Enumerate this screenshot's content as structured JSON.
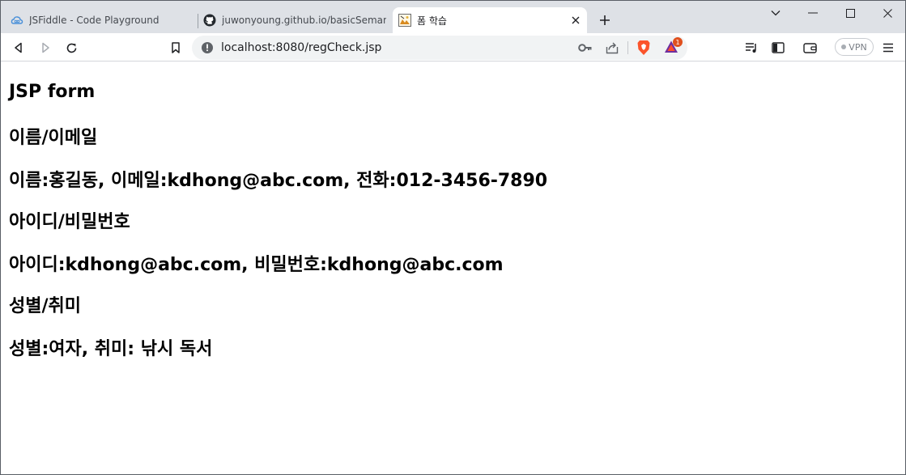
{
  "tabs": [
    {
      "title": "JSFiddle - Code Playground",
      "icon": "jsfiddle-icon"
    },
    {
      "title": "juwonyoung.github.io/basicSemantic-",
      "icon": "github-icon"
    },
    {
      "title": "폼 학습",
      "icon": "page-favicon"
    }
  ],
  "address_bar": {
    "url": "localhost:8080/regCheck.jsp"
  },
  "rewards_badge": "1",
  "vpn_label": "VPN",
  "page": {
    "heading": "JSP form",
    "section_name_email": "이름/이메일",
    "name_email_value": "이름:홍길동, 이메일:kdhong@abc.com, 전화:012-3456-7890",
    "section_id_password": "아이디/비밀번호",
    "id_password_value": "아이디:kdhong@abc.com, 비밀번호:kdhong@abc.com",
    "section_gender_hobby": "성별/취미",
    "gender_hobby_value": "성별:여자, 취미: 낚시 독서"
  },
  "colors": {
    "tabstrip": "#dee1e6",
    "active_tab": "#ffffff",
    "omnibox": "#f1f3f4",
    "brave_orange": "#fb542b"
  }
}
